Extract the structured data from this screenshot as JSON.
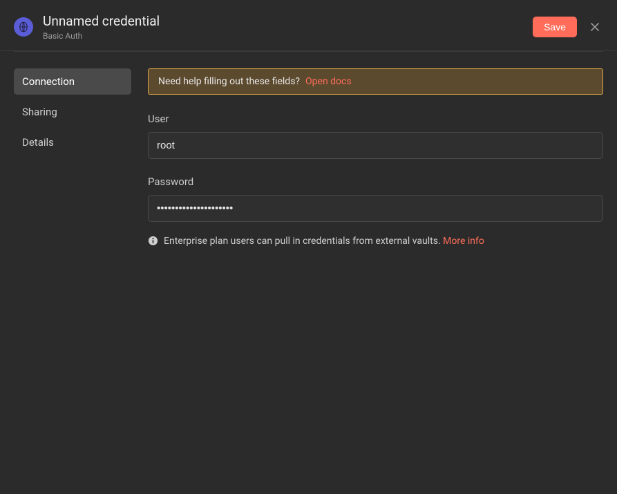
{
  "header": {
    "title": "Unnamed credential",
    "subtitle": "Basic Auth",
    "save_label": "Save"
  },
  "sidebar": {
    "tabs": [
      {
        "label": "Connection",
        "active": true
      },
      {
        "label": "Sharing",
        "active": false
      },
      {
        "label": "Details",
        "active": false
      }
    ]
  },
  "banner": {
    "text": "Need help filling out these fields?",
    "link": "Open docs"
  },
  "fields": {
    "user": {
      "label": "User",
      "value": "root"
    },
    "password": {
      "label": "Password",
      "value": "•••••••••••••••••••••"
    }
  },
  "info": {
    "text": "Enterprise plan users can pull in credentials from external vaults.",
    "link": "More info"
  }
}
